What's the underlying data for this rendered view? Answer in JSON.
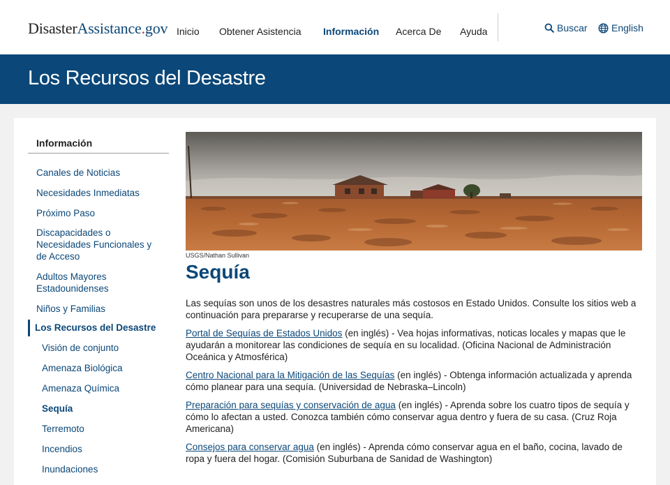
{
  "header": {
    "logo": {
      "part1": "Disaster",
      "part2": "Assistance",
      "dot": ".",
      "part3": "gov"
    },
    "nav": [
      "Inicio",
      "Obtener Asistencia",
      "Información",
      "Acerca De",
      "Ayuda"
    ],
    "search_label": "Buscar",
    "language_label": "English"
  },
  "banner": {
    "title": "Los Recursos del Desastre"
  },
  "sidebar": {
    "title": "Información",
    "items": [
      "Canales de Noticias",
      "Necesidades Inmediatas",
      "Próximo Paso",
      "Discapacidades o Necesidades Funcionales y de Acceso",
      "Adultos Mayores Estadounidenses",
      "Niños y Familias"
    ],
    "active": "Los Recursos del Desastre",
    "subitems": [
      "Visión de conjunto",
      "Amenaza Biológica",
      "Amenaza Química",
      "Sequía",
      "Terremoto",
      "Incendios",
      "Inundaciones"
    ]
  },
  "main": {
    "image_credit": "USGS/Nathan Sullivan",
    "heading": "Sequía",
    "intro": "Las sequías son unos de los desastres naturales más costosos en Estado Unidos. Consulte los sitios web a continuación para prepararse y recuperarse de una sequía.",
    "resources": [
      {
        "link": "Portal de Sequías de Estados Unidos",
        "text": " (en inglés) - Vea hojas informativas, noticas locales y mapas que le ayudarán a monitorear las condiciones de sequía en su localidad. (Oficina Nacional de Administración Oceánica y Atmosférica)"
      },
      {
        "link": "Centro Nacional para la Mitigación de las Sequías",
        "text": " (en inglés) - Obtenga información actualizada y aprenda cómo planear para una sequía. (Universidad de Nebraska–Lincoln)"
      },
      {
        "link": "Preparación para sequías y conservación de agua",
        "text": " (en inglés) - Aprenda sobre los cuatro tipos de sequía y cómo lo afectan a usted. Conozca también cómo conservar agua dentro y fuera de su casa. (Cruz Roja Americana)"
      },
      {
        "link": "Consejos para conservar agua",
        "text": " (en inglés) - Aprenda cómo conservar agua en el baño, cocina, lavado de ropa y fuera del hogar. (Comisión Suburbana de Sanidad de Washington)"
      }
    ]
  },
  "colors": {
    "brand": "#0b4778",
    "logo_dot": "#c22d2d",
    "background": "#f1f1f1"
  },
  "icons": [
    "search-icon",
    "globe-icon"
  ]
}
